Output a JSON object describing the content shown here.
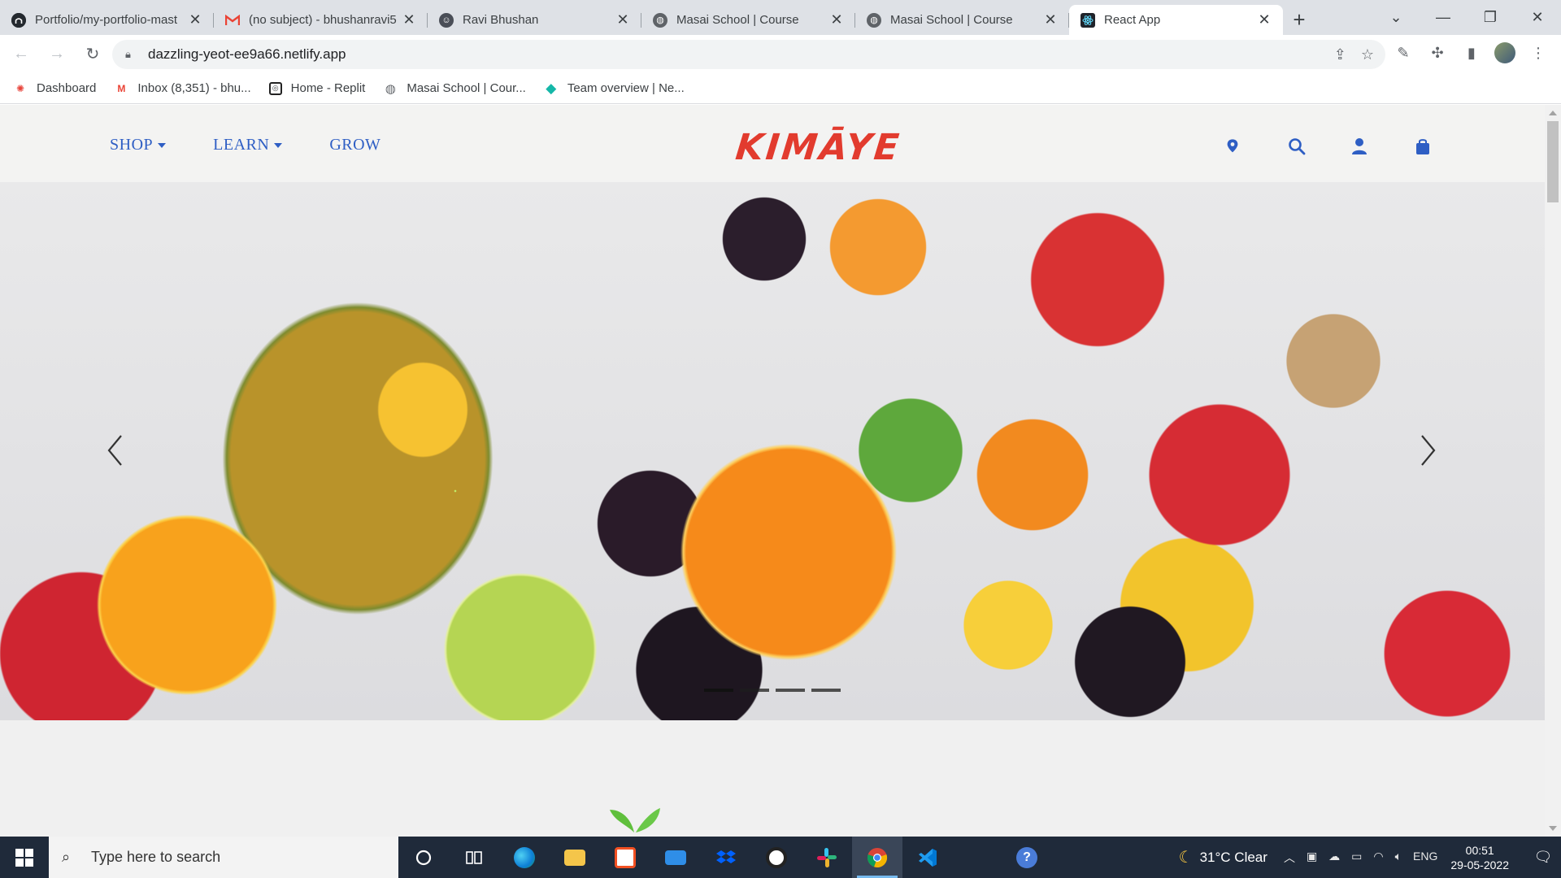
{
  "browser": {
    "tabs": [
      {
        "title": "Portfolio/my-portfolio-mast",
        "favicon": "github-icon",
        "active": false
      },
      {
        "title": "(no subject) - bhushanravi5",
        "favicon": "gmail-icon",
        "active": false
      },
      {
        "title": "Ravi Bhushan",
        "favicon": "profile-icon",
        "active": false
      },
      {
        "title": "Masai School | Course",
        "favicon": "globe-icon",
        "active": false
      },
      {
        "title": "Masai School | Course",
        "favicon": "globe-icon",
        "active": false
      },
      {
        "title": "React App",
        "favicon": "react-icon",
        "active": true
      }
    ],
    "new_tab_label": "+",
    "url": "dazzling-yeot-ee9a66.netlify.app",
    "bookmarks": [
      {
        "label": "Dashboard",
        "icon": "dashboard-icon"
      },
      {
        "label": "Inbox (8,351) - bhu...",
        "icon": "gmail-icon"
      },
      {
        "label": "Home - Replit",
        "icon": "replit-icon"
      },
      {
        "label": "Masai School | Cour...",
        "icon": "globe-icon"
      },
      {
        "label": "Team overview | Ne...",
        "icon": "netlify-icon"
      }
    ]
  },
  "site": {
    "menu": [
      {
        "label": "SHOP",
        "dropdown": true
      },
      {
        "label": "LEARN",
        "dropdown": true
      },
      {
        "label": "GROW",
        "dropdown": false
      }
    ],
    "logo": "KIMĀYE",
    "icons": [
      "location-pin-icon",
      "search-icon",
      "user-icon",
      "shopping-bag-icon"
    ],
    "accent_color": "#2e5ec4",
    "logo_color": "#e23b2e",
    "hero": {
      "image": "fresh fruit platter",
      "slides": 4,
      "active_slide": 1
    }
  },
  "taskbar": {
    "search_placeholder": "Type here to search",
    "apps": [
      "cortana-icon",
      "task-view-icon",
      "edge-icon",
      "file-explorer-icon",
      "store-icon",
      "mail-icon",
      "dropbox-icon",
      "github-desktop-icon",
      "slack-icon",
      "chrome-icon",
      "vscode-icon",
      "help-icon"
    ],
    "weather": "31°C  Clear",
    "language": "ENG",
    "time": "00:51",
    "date": "29-05-2022"
  }
}
